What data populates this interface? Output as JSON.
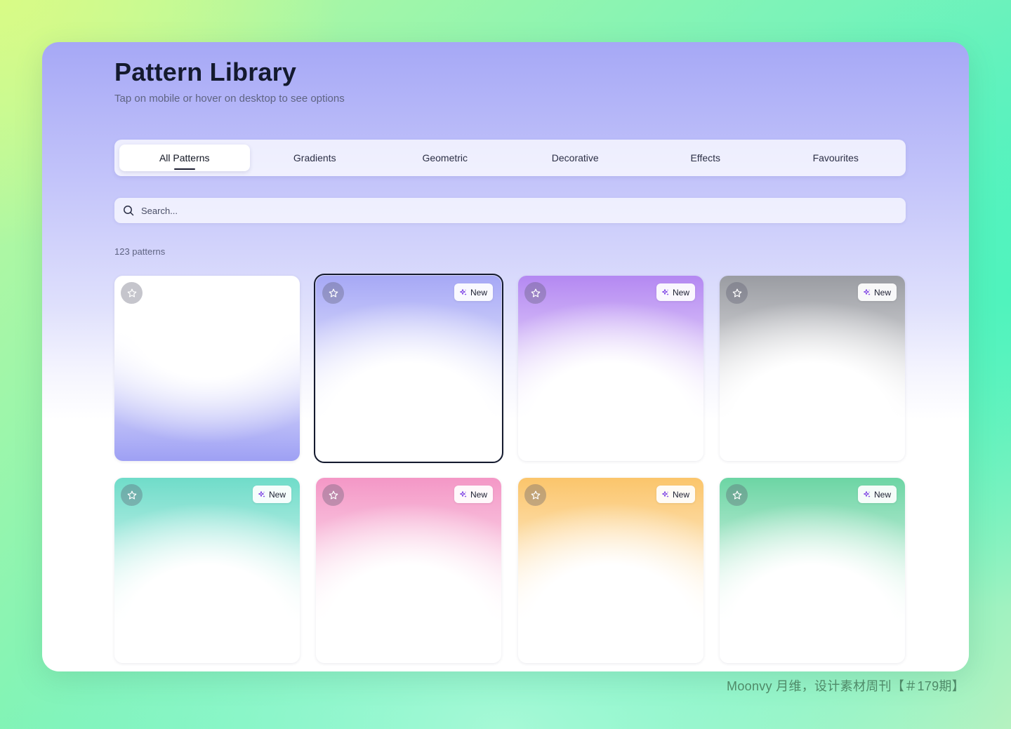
{
  "header": {
    "title": "Pattern Library",
    "subtitle": "Tap on mobile or hover on desktop to see options"
  },
  "tabs": [
    {
      "label": "All Patterns",
      "active": true
    },
    {
      "label": "Gradients"
    },
    {
      "label": "Geometric"
    },
    {
      "label": "Decorative"
    },
    {
      "label": "Effects"
    },
    {
      "label": "Favourites"
    }
  ],
  "search": {
    "placeholder": "Search..."
  },
  "result_count": "123 patterns",
  "cards": [
    {
      "accent": "#9ea0f4",
      "style": "bottom",
      "badge": "",
      "icon": "star-icon"
    },
    {
      "accent": "#a6a8f6",
      "style": "top",
      "badge": "New",
      "selected": true,
      "icon": "star-icon"
    },
    {
      "accent": "#b488f2",
      "style": "top",
      "badge": "New",
      "icon": "star-icon"
    },
    {
      "accent": "#9a9ca2",
      "style": "top",
      "badge": "New",
      "icon": "star-icon"
    },
    {
      "accent": "#6fdcc9",
      "style": "top",
      "badge": "New",
      "icon": "star-icon"
    },
    {
      "accent": "#f497c6",
      "style": "top",
      "badge": "New",
      "icon": "star-icon"
    },
    {
      "accent": "#fbc56b",
      "style": "top",
      "badge": "New",
      "icon": "star-icon"
    },
    {
      "accent": "#6cd5a4",
      "style": "top",
      "badge": "New",
      "icon": "star-icon"
    }
  ],
  "badge_icon": "sparkles-icon",
  "watermark": "Moonvy 月维，设计素材周刊【＃179期】"
}
